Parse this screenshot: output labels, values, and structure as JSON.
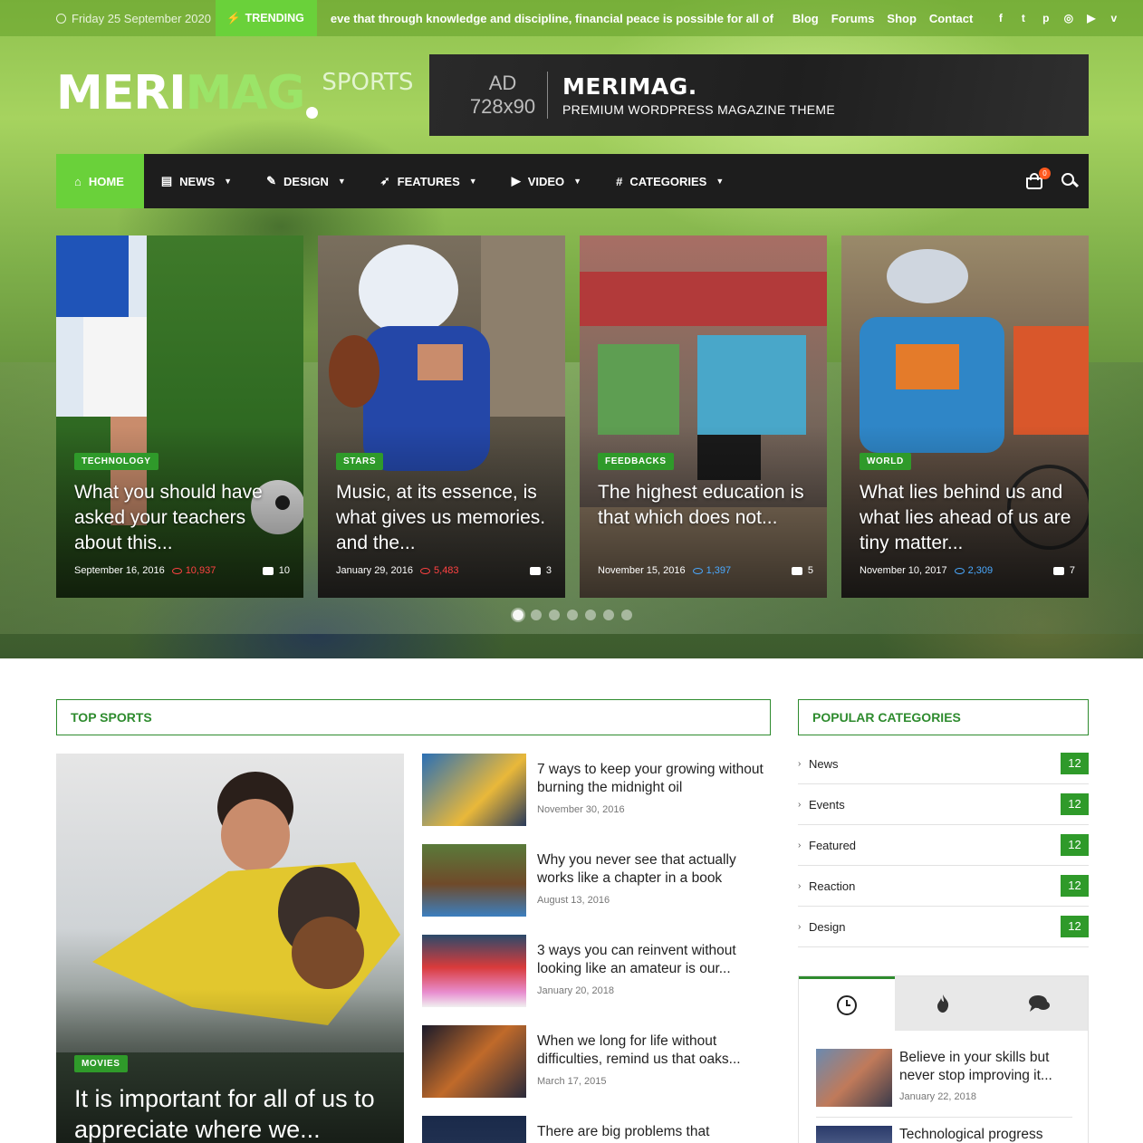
{
  "topbar": {
    "date": "Friday 25 September 2020",
    "trending_label": "TRENDING",
    "ticker": "eve that through knowledge and discipline, financial peace is possible for all of us",
    "links": [
      "Blog",
      "Forums",
      "Shop",
      "Contact"
    ],
    "social": [
      {
        "name": "facebook-icon",
        "glyph": "f"
      },
      {
        "name": "twitter-icon",
        "glyph": "t"
      },
      {
        "name": "pinterest-icon",
        "glyph": "p"
      },
      {
        "name": "instagram-icon",
        "glyph": "◎"
      },
      {
        "name": "youtube-icon",
        "glyph": "▶"
      },
      {
        "name": "vimeo-icon",
        "glyph": "v"
      }
    ]
  },
  "logo": {
    "part1": "MERI",
    "part2": "MAG",
    "part3": "SPORTS"
  },
  "ad": {
    "label": "AD",
    "size": "728x90",
    "brand": "MERIMAG.",
    "tagline": "PREMIUM WORDPRESS MAGAZINE THEME"
  },
  "nav": {
    "items": [
      {
        "label": "HOME",
        "icon": "home-icon",
        "active": true
      },
      {
        "label": "NEWS",
        "icon": "newspaper-icon",
        "active": false
      },
      {
        "label": "DESIGN",
        "icon": "magic-wand-icon",
        "active": false
      },
      {
        "label": "FEATURES",
        "icon": "rocket-icon",
        "active": false
      },
      {
        "label": "VIDEO",
        "icon": "play-icon",
        "active": false
      },
      {
        "label": "CATEGORIES",
        "icon": "hashtag-icon",
        "active": false
      }
    ],
    "cart_count": "0"
  },
  "slider": {
    "cards": [
      {
        "category": "TECHNOLOGY",
        "title": "What you should have asked your teachers about this...",
        "date": "September 16, 2016",
        "views": "10,937",
        "views_color": "red",
        "comments": "10"
      },
      {
        "category": "STARS",
        "title": "Music, at its essence, is what gives us memories. and the...",
        "date": "January 29, 2016",
        "views": "5,483",
        "views_color": "red",
        "comments": "3"
      },
      {
        "category": "FEEDBACKS",
        "title": "The highest education is that which does not...",
        "date": "November 15, 2016",
        "views": "1,397",
        "views_color": "blue",
        "comments": "5"
      },
      {
        "category": "WORLD",
        "title": "What lies behind us and what lies ahead of us are tiny matter...",
        "date": "November 10, 2017",
        "views": "2,309",
        "views_color": "blue",
        "comments": "7"
      }
    ],
    "dot_count": 7,
    "active_dot": 0
  },
  "top_sports": {
    "title": "TOP SPORTS",
    "featured": {
      "category": "MOVIES",
      "title": "It is important for all of us to appreciate where we..."
    },
    "posts": [
      {
        "title": "7 ways to keep your growing without burning the midnight oil",
        "date": "November 30, 2016"
      },
      {
        "title": "Why you never see that actually works like a chapter in a book",
        "date": "August 13, 2016"
      },
      {
        "title": "3 ways you can reinvent without looking like an amateur is our...",
        "date": "January 20, 2018"
      },
      {
        "title": "When we long for life without difficulties, remind us that oaks...",
        "date": "March 17, 2015"
      },
      {
        "title": "There are big problems that",
        "date": ""
      }
    ]
  },
  "popular_categories": {
    "title": "POPULAR CATEGORIES",
    "items": [
      {
        "name": "News",
        "count": "12"
      },
      {
        "name": "Events",
        "count": "12"
      },
      {
        "name": "Featured",
        "count": "12"
      },
      {
        "name": "Reaction",
        "count": "12"
      },
      {
        "name": "Design",
        "count": "12"
      }
    ]
  },
  "tab_widget": {
    "tabs": [
      "clock-icon",
      "fire-icon",
      "comments-icon"
    ],
    "posts": [
      {
        "title": "Believe in your skills but never stop improving it...",
        "date": "January 22, 2018"
      },
      {
        "title": "Technological progress",
        "date": ""
      }
    ]
  },
  "colors": {
    "accent": "#6ad13a",
    "badge": "#2f9a2a",
    "title_green": "#2e8b2e",
    "nav_bg": "#1d1d1d"
  }
}
